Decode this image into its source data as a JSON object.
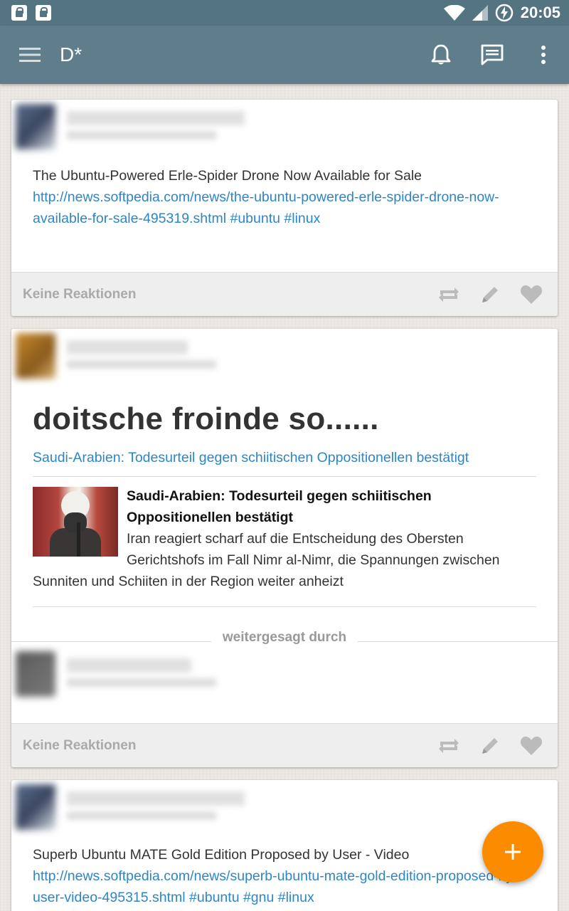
{
  "statusbar": {
    "time": "20:05",
    "icons": [
      "lock-icon",
      "lock-icon",
      "wifi-icon",
      "signal-icon",
      "battery-charging-icon"
    ]
  },
  "appbar": {
    "title": "D*",
    "icons": [
      "menu-icon",
      "bell-icon",
      "chat-icon",
      "more-vert-icon"
    ]
  },
  "posts": [
    {
      "text": "The Ubuntu-Powered Erle-Spider Drone Now Available for Sale",
      "link": "http://news.softpedia.com/news/the-ubuntu-powered-erle-spider-drone-now-available-for-sale-495319.shtml",
      "tags": "#ubuntu #linux",
      "reactions": "Keine Reaktionen"
    },
    {
      "headline": "doitsche froinde so......",
      "link": "Saudi-Arabien: Todesurteil gegen schiitischen Oppositionellen bestätigt",
      "preview_title": "Saudi-Arabien: Todesurteil gegen schiitischen Oppositionellen bestätigt",
      "preview_text": "Iran reagiert scharf auf die Entscheidung des Obersten Gerichtshofs im Fall Nimr al-Nimr, die Spannungen zwischen Sunniten und Schiiten in der Region weiter anheizt",
      "reshared_label": "weitergesagt durch",
      "reactions": "Keine Reaktionen"
    },
    {
      "text": "Superb Ubuntu MATE Gold Edition Proposed by User - Video",
      "link": "http://news.softpedia.com/news/superb-ubuntu-mate-gold-edition-proposed-by-user-video-495315.shtml",
      "tags": "#ubuntu #gnu #linux"
    }
  ],
  "colors": {
    "statusbar": "#557482",
    "appbar": "#5f7d8b",
    "link": "#2c86c8",
    "fab": "#fb8c00"
  },
  "fab": {
    "icon": "plus-icon"
  }
}
